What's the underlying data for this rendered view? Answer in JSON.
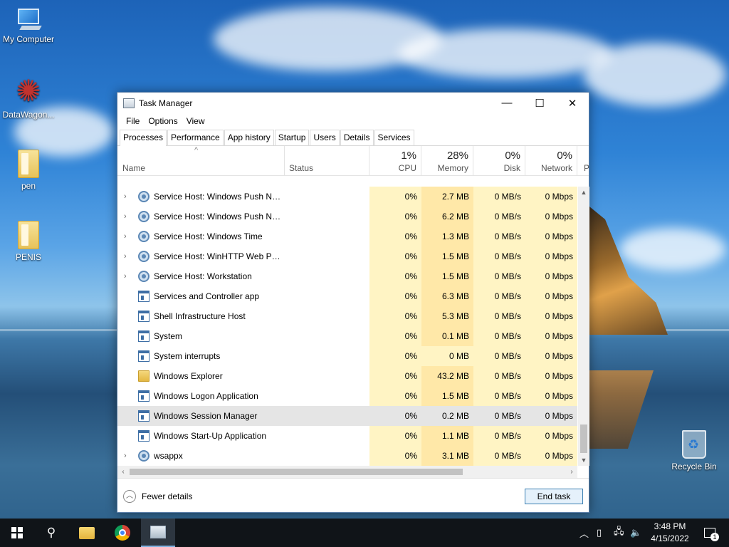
{
  "desktop": {
    "icons": [
      {
        "label": "My Computer"
      },
      {
        "label": "DataWagon..."
      },
      {
        "label": "pen"
      },
      {
        "label": "PENIS"
      },
      {
        "label": "Recycle Bin"
      }
    ]
  },
  "window": {
    "title": "Task Manager",
    "controls": {
      "minimize": "—",
      "maximize": "☐",
      "close": "✕"
    },
    "menu": [
      "File",
      "Options",
      "View"
    ],
    "tabs": [
      "Processes",
      "Performance",
      "App history",
      "Startup",
      "Users",
      "Details",
      "Services"
    ],
    "active_tab": "Processes",
    "columns": {
      "name": "Name",
      "status": "Status",
      "cpu": {
        "pct": "1%",
        "label": "CPU"
      },
      "memory": {
        "pct": "28%",
        "label": "Memory"
      },
      "disk": {
        "pct": "0%",
        "label": "Disk"
      },
      "network": {
        "pct": "0%",
        "label": "Network"
      },
      "extra": "P"
    },
    "processes": [
      {
        "name": "Service Host: Windows Push No...",
        "icon": "gear-icon",
        "expandable": true,
        "cpu": "0%",
        "memory": "2.7 MB",
        "disk": "0 MB/s",
        "network": "0 Mbps"
      },
      {
        "name": "Service Host: Windows Push No...",
        "icon": "gear-icon",
        "expandable": true,
        "cpu": "0%",
        "memory": "6.2 MB",
        "disk": "0 MB/s",
        "network": "0 Mbps"
      },
      {
        "name": "Service Host: Windows Time",
        "icon": "gear-icon",
        "expandable": true,
        "cpu": "0%",
        "memory": "1.3 MB",
        "disk": "0 MB/s",
        "network": "0 Mbps"
      },
      {
        "name": "Service Host: WinHTTP Web Pro...",
        "icon": "gear-icon",
        "expandable": true,
        "cpu": "0%",
        "memory": "1.5 MB",
        "disk": "0 MB/s",
        "network": "0 Mbps"
      },
      {
        "name": "Service Host: Workstation",
        "icon": "gear-icon",
        "expandable": true,
        "cpu": "0%",
        "memory": "1.5 MB",
        "disk": "0 MB/s",
        "network": "0 Mbps"
      },
      {
        "name": "Services and Controller app",
        "icon": "app-window-icon",
        "expandable": false,
        "cpu": "0%",
        "memory": "6.3 MB",
        "disk": "0 MB/s",
        "network": "0 Mbps"
      },
      {
        "name": "Shell Infrastructure Host",
        "icon": "app-window-icon",
        "expandable": false,
        "cpu": "0%",
        "memory": "5.3 MB",
        "disk": "0 MB/s",
        "network": "0 Mbps"
      },
      {
        "name": "System",
        "icon": "app-window-icon",
        "expandable": false,
        "cpu": "0%",
        "memory": "0.1 MB",
        "disk": "0 MB/s",
        "network": "0 Mbps"
      },
      {
        "name": "System interrupts",
        "icon": "app-window-icon",
        "expandable": false,
        "cpu": "0%",
        "memory": "0 MB",
        "disk": "0 MB/s",
        "network": "0 Mbps"
      },
      {
        "name": "Windows Explorer",
        "icon": "folder-icon",
        "expandable": false,
        "cpu": "0%",
        "memory": "43.2 MB",
        "disk": "0 MB/s",
        "network": "0 Mbps"
      },
      {
        "name": "Windows Logon Application",
        "icon": "app-window-icon",
        "expandable": false,
        "cpu": "0%",
        "memory": "1.5 MB",
        "disk": "0 MB/s",
        "network": "0 Mbps"
      },
      {
        "name": "Windows Session Manager",
        "icon": "app-window-icon",
        "expandable": false,
        "selected": true,
        "cpu": "0%",
        "memory": "0.2 MB",
        "disk": "0 MB/s",
        "network": "0 Mbps"
      },
      {
        "name": "Windows Start-Up Application",
        "icon": "app-window-icon",
        "expandable": false,
        "cpu": "0%",
        "memory": "1.1 MB",
        "disk": "0 MB/s",
        "network": "0 Mbps"
      },
      {
        "name": "wsappx",
        "icon": "gear-icon",
        "expandable": true,
        "cpu": "0%",
        "memory": "3.1 MB",
        "disk": "0 MB/s",
        "network": "0 Mbps"
      }
    ],
    "footer": {
      "fewer_details": "Fewer details",
      "end_task": "End task"
    },
    "colors": {
      "heat_light": "#fff4c4",
      "heat_mid": "#ffe8a8",
      "selected_row": "#e5e5e5"
    }
  },
  "taskbar": {
    "time": "3:48 PM",
    "date": "4/15/2022",
    "notification_count": "1"
  }
}
